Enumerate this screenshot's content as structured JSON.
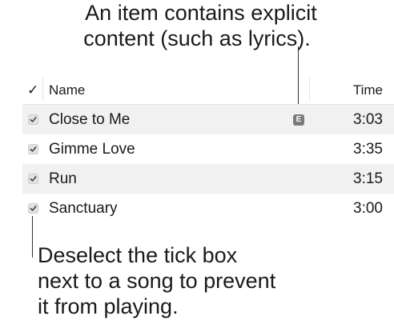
{
  "callouts": {
    "explicit_line1": "An item contains explicit",
    "explicit_line2": "content (such as lyrics).",
    "tickbox_line1": "Deselect the tick box",
    "tickbox_line2": "next to a song to prevent",
    "tickbox_line3": "it from playing."
  },
  "table": {
    "header": {
      "check_symbol": "✓",
      "name": "Name",
      "time": "Time"
    },
    "rows": [
      {
        "checked": true,
        "name": "Close to Me",
        "explicit_badge": "E",
        "time": "3:03"
      },
      {
        "checked": true,
        "name": "Gimme Love",
        "time": "3:35"
      },
      {
        "checked": true,
        "name": "Run",
        "time": "3:15"
      },
      {
        "checked": true,
        "name": "Sanctuary",
        "time": "3:00"
      }
    ]
  },
  "icons": {
    "checkbox": "checkmark-icon",
    "explicit": "explicit-badge-icon"
  },
  "colors": {
    "row_shade": "#f1f1f1",
    "badge": "#7a7a7a",
    "text": "#1a1a1a"
  }
}
